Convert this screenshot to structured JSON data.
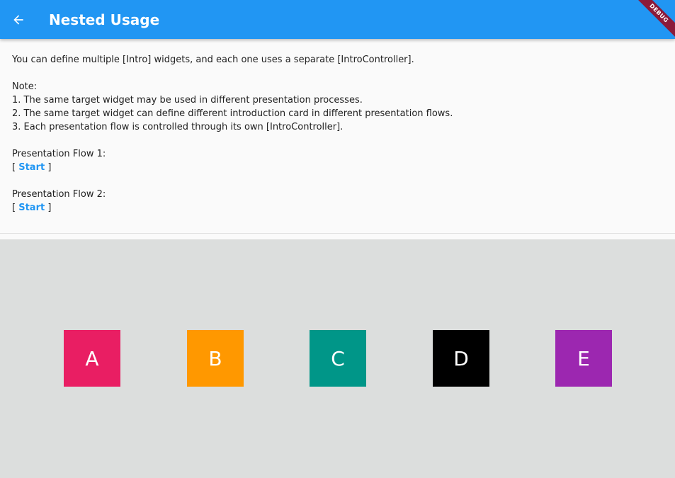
{
  "appbar": {
    "title": "Nested Usage",
    "back_icon": "arrow-left-icon",
    "debug_banner": "DEBUG"
  },
  "content": {
    "intro": "You can define multiple [Intro] widgets, and each one uses a separate [IntroController].",
    "note_heading": "Note:",
    "notes": [
      "1. The same target widget may be used in different presentation processes.",
      "2. The same target widget can define different introduction card in different presentation flows.",
      "3. Each presentation flow is controlled through its own [IntroController]."
    ],
    "flow1_label": "Presentation Flow 1:",
    "flow2_label": "Presentation Flow 2:",
    "bracket_open": "[ ",
    "bracket_close": " ]",
    "start_label": "Start"
  },
  "boxes": [
    {
      "label": "A",
      "color": "#e91e63"
    },
    {
      "label": "B",
      "color": "#ff9800"
    },
    {
      "label": "C",
      "color": "#009688"
    },
    {
      "label": "D",
      "color": "#000000"
    },
    {
      "label": "E",
      "color": "#9c27b0"
    }
  ],
  "colors": {
    "appbar": "#2196f3",
    "link": "#2196f3",
    "panel_bg": "#dcdedd"
  }
}
